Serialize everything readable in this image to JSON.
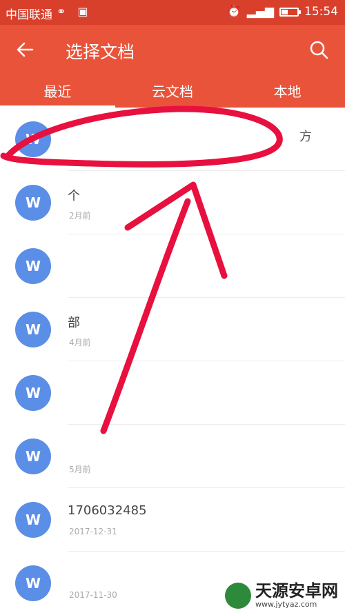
{
  "status_bar": {
    "carrier": "中国联通",
    "time": "15:54"
  },
  "header": {
    "title": "选择文档",
    "tabs": [
      {
        "label": "最近"
      },
      {
        "label": "云文档"
      },
      {
        "label": "本地"
      }
    ]
  },
  "files": [
    {
      "icon": "W",
      "name": "",
      "meta": "",
      "extra": "方"
    },
    {
      "icon": "W",
      "name": "个",
      "meta": "2月前",
      "extra": ""
    },
    {
      "icon": "W",
      "name": "",
      "meta": "",
      "extra": ""
    },
    {
      "icon": "W",
      "name": "部",
      "meta": "4月前",
      "extra": ""
    },
    {
      "icon": "W",
      "name": "",
      "meta": "",
      "extra": ""
    },
    {
      "icon": "W",
      "name": "",
      "meta": "5月前",
      "extra": ""
    },
    {
      "icon": "W",
      "name": "17060324​85",
      "meta": "2017-12-31",
      "extra": ""
    },
    {
      "icon": "W",
      "name": "",
      "meta": "2017-11-30",
      "extra": ""
    }
  ],
  "watermark": {
    "brand": "天源安卓网",
    "url": "www.jytyaz.com"
  },
  "colors": {
    "status_bar": "#d9402c",
    "app_bar": "#e9533a",
    "file_icon": "#5b8ee6",
    "annotation": "#e8103f"
  }
}
